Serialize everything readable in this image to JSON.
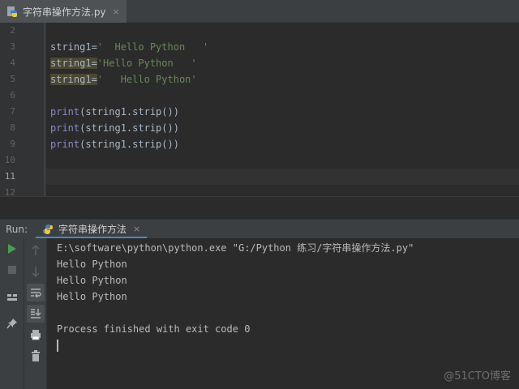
{
  "editor": {
    "tab_label": "字符串操作方法.py",
    "tab_close": "×",
    "line_numbers": [
      "2",
      "3",
      "4",
      "5",
      "6",
      "7",
      "8",
      "9",
      "10",
      "11",
      "12"
    ],
    "current_line": "11",
    "code_lines": {
      "line3": {
        "var": "string1=",
        "str": "'  Hello Python   '"
      },
      "line4": {
        "var": "string1=",
        "str": "'Hello Python   '"
      },
      "line5": {
        "var": "string1=",
        "str": "'   Hello Python'"
      },
      "line7": {
        "fn": "print",
        "rest": "(string1.strip())"
      },
      "line8": {
        "fn": "print",
        "rest": "(string1.strip())"
      },
      "line9": {
        "fn": "print",
        "rest": "(string1.strip())"
      }
    }
  },
  "run": {
    "title": "Run:",
    "tab_label": "字符串操作方法",
    "tab_close": "×",
    "console_lines": [
      "E:\\software\\python\\python.exe \"G:/Python 练习/字符串操作方法.py\"",
      "Hello Python",
      "Hello Python",
      "Hello Python",
      "",
      "Process finished with exit code 0"
    ]
  },
  "watermark": "@51CTO博客",
  "colors": {
    "accent": "#4a88c7",
    "run_green": "#499c54",
    "string": "#6a8759",
    "builtin": "#8888c6",
    "highlight": "#4c4733"
  }
}
